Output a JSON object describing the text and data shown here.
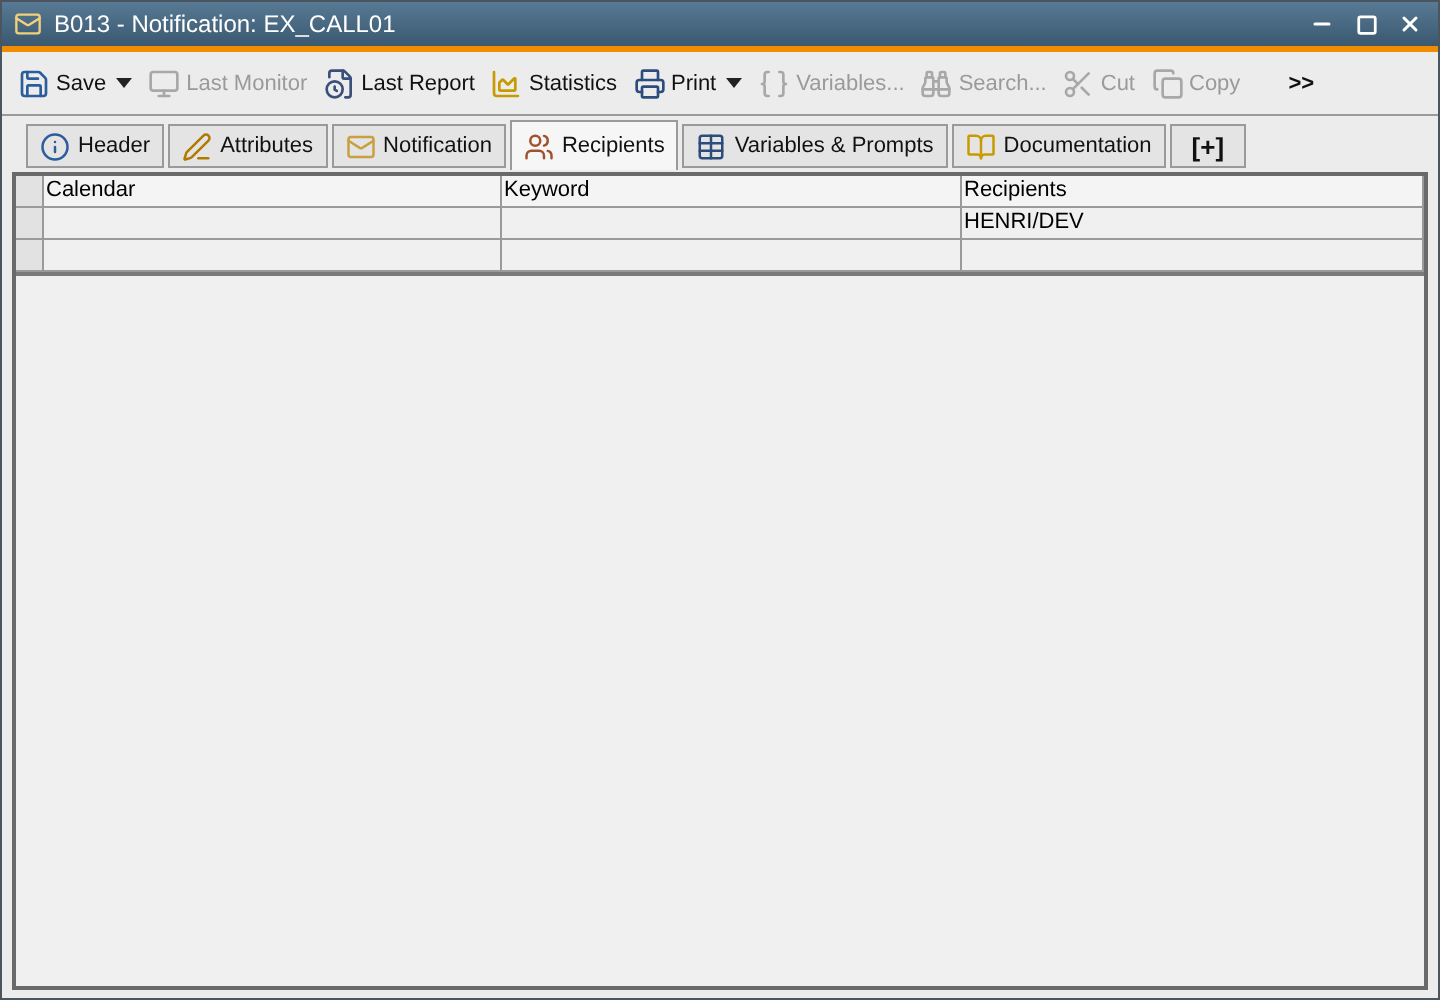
{
  "window": {
    "title": "B013 - Notification: EX_CALL01"
  },
  "toolbar": [
    {
      "label": "Save",
      "kind": "dropdown",
      "disabled": false
    },
    {
      "label": "Last Monitor",
      "kind": "button",
      "disabled": true
    },
    {
      "label": "Last Report",
      "kind": "button",
      "disabled": false
    },
    {
      "label": "Statistics",
      "kind": "button",
      "disabled": false
    },
    {
      "label": "Print",
      "kind": "dropdown",
      "disabled": false
    },
    {
      "label": "Variables...",
      "kind": "button",
      "disabled": true
    },
    {
      "label": "Search...",
      "kind": "button",
      "disabled": true
    },
    {
      "label": "Cut",
      "kind": "button",
      "disabled": true
    },
    {
      "label": "Copy",
      "kind": "button",
      "disabled": true
    },
    {
      "label": ">>",
      "kind": "overflow",
      "disabled": false
    }
  ],
  "tabs": [
    {
      "label": "Header",
      "selected": false
    },
    {
      "label": "Attributes",
      "selected": false
    },
    {
      "label": "Notification",
      "selected": false
    },
    {
      "label": "Recipients",
      "selected": true
    },
    {
      "label": "Variables & Prompts",
      "selected": false
    },
    {
      "label": "Documentation",
      "selected": false
    },
    {
      "label": "[+]",
      "selected": false
    }
  ],
  "table": {
    "columns": [
      "Calendar",
      "Keyword",
      "Recipients"
    ],
    "rows": [
      {
        "cells": [
          null,
          null,
          "HENRI/DEV"
        ]
      },
      {
        "cells": [
          null,
          null,
          null
        ]
      }
    ]
  }
}
